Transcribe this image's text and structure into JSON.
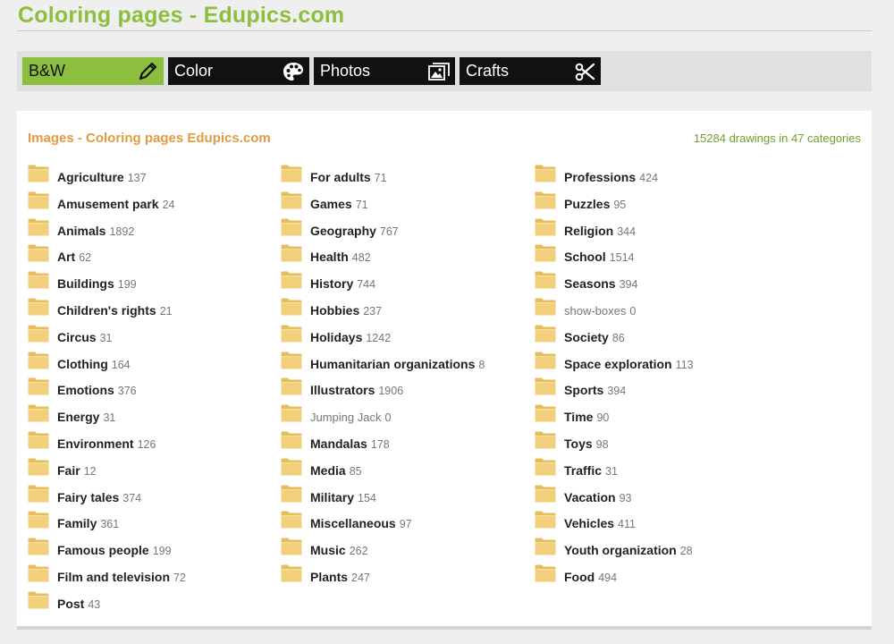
{
  "site": {
    "title": "Coloring pages - Edupics.com"
  },
  "tabs": [
    {
      "label": "B&W",
      "icon": "pencil-icon",
      "active": true
    },
    {
      "label": "Color",
      "icon": "palette-icon",
      "active": false
    },
    {
      "label": "Photos",
      "icon": "photos-icon",
      "active": false
    },
    {
      "label": "Crafts",
      "icon": "scissors-icon",
      "active": false
    }
  ],
  "panel": {
    "title": "Images - Coloring pages Edupics.com",
    "summary": "15284 drawings in 47 categories"
  },
  "columns": [
    [
      {
        "name": "Agriculture",
        "count": "137"
      },
      {
        "name": "Amusement park",
        "count": "24"
      },
      {
        "name": "Animals",
        "count": "1892"
      },
      {
        "name": "Art",
        "count": "62"
      },
      {
        "name": "Buildings",
        "count": "199"
      },
      {
        "name": "Children's rights",
        "count": "21"
      },
      {
        "name": "Circus",
        "count": "31"
      },
      {
        "name": "Clothing",
        "count": "164"
      },
      {
        "name": "Emotions",
        "count": "376"
      },
      {
        "name": "Energy",
        "count": "31"
      },
      {
        "name": "Environment",
        "count": "126"
      },
      {
        "name": "Fair",
        "count": "12"
      },
      {
        "name": "Fairy tales",
        "count": "374"
      },
      {
        "name": "Family",
        "count": "361"
      },
      {
        "name": "Famous people",
        "count": "199"
      },
      {
        "name": "Film and television",
        "count": "72"
      },
      {
        "name": "Post",
        "count": "43"
      }
    ],
    [
      {
        "name": "For adults",
        "count": "71"
      },
      {
        "name": "Games",
        "count": "71"
      },
      {
        "name": "Geography",
        "count": "767"
      },
      {
        "name": "Health",
        "count": "482"
      },
      {
        "name": "History",
        "count": "744"
      },
      {
        "name": "Hobbies",
        "count": "237"
      },
      {
        "name": "Holidays",
        "count": "1242"
      },
      {
        "name": "Humanitarian organizations",
        "count": "8"
      },
      {
        "name": "Illustrators",
        "count": "1906"
      },
      {
        "name": "Jumping Jack",
        "count": "0",
        "empty": true
      },
      {
        "name": "Mandalas",
        "count": "178"
      },
      {
        "name": "Media",
        "count": "85"
      },
      {
        "name": "Military",
        "count": "154"
      },
      {
        "name": "Miscellaneous",
        "count": "97"
      },
      {
        "name": "Music",
        "count": "262"
      },
      {
        "name": "Plants",
        "count": "247"
      }
    ],
    [
      {
        "name": "Professions",
        "count": "424"
      },
      {
        "name": "Puzzles",
        "count": "95"
      },
      {
        "name": "Religion",
        "count": "344"
      },
      {
        "name": "School",
        "count": "1514"
      },
      {
        "name": "Seasons",
        "count": "394"
      },
      {
        "name": "show-boxes",
        "count": "0",
        "empty": true
      },
      {
        "name": "Society",
        "count": "86"
      },
      {
        "name": "Space exploration",
        "count": "113"
      },
      {
        "name": "Sports",
        "count": "394"
      },
      {
        "name": "Time",
        "count": "90"
      },
      {
        "name": "Toys",
        "count": "98"
      },
      {
        "name": "Traffic",
        "count": "31"
      },
      {
        "name": "Vacation",
        "count": "93"
      },
      {
        "name": "Vehicles",
        "count": "411"
      },
      {
        "name": "Youth organization",
        "count": "28"
      },
      {
        "name": "Food",
        "count": "494"
      }
    ]
  ],
  "colors": {
    "brand_green": "#8cbf3f",
    "heading_orange": "#e39a43",
    "summary_green": "#6f9f2c",
    "folder_yellow": "#f1cf7b"
  }
}
